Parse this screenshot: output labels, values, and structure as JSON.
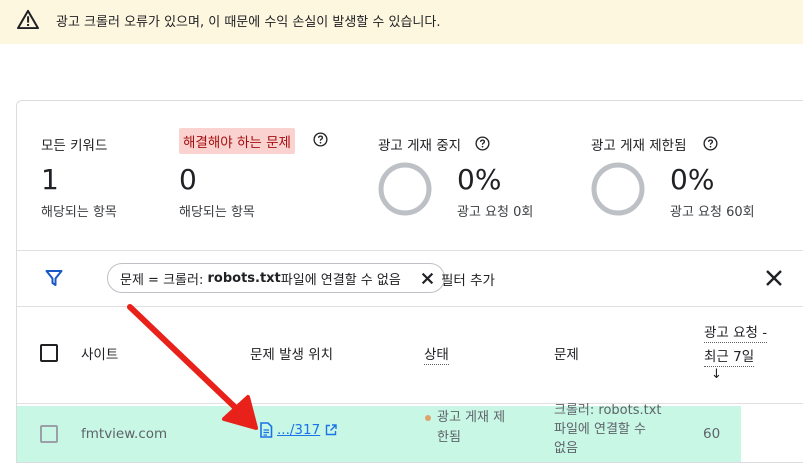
{
  "banner": {
    "message": "광고 크롤러 오류가 있으며, 이 때문에 수익 손실이 발생할 수 있습니다.",
    "icon": "warning-icon"
  },
  "stats": {
    "all_keywords": {
      "label": "모든 키워드",
      "value": "1",
      "sub": "해당되는 항목"
    },
    "to_resolve": {
      "label": "해결해야 하는 문제",
      "value": "0",
      "sub": "해당되는 항목"
    },
    "ad_stopped": {
      "label": "광고 게재 중지",
      "value": "0%",
      "sub": "광고 요청 0회"
    },
    "ad_limited": {
      "label": "광고 게재 제한됨",
      "value": "0%",
      "sub": "광고 요청 60회"
    }
  },
  "filter": {
    "chip_prefix": "문제 = 크롤러: ",
    "chip_bold": "robots.txt",
    "chip_suffix": " 파일에 연결할 수 없음",
    "add_label": "필터 추가"
  },
  "table": {
    "headers": {
      "site": "사이트",
      "location": "문제 발생 위치",
      "status": "상태",
      "issue": "문제",
      "requests_line1": "광고 요청 -",
      "requests_line2": "최근 7일",
      "sort_arrow": "↓"
    },
    "rows": [
      {
        "site": "fmtview.com",
        "location": ".../317",
        "status_line1": "광고 게재 제",
        "status_line2": "한됨",
        "issue_line1": "크롤러: robots.txt",
        "issue_line2": "파일에 연결할 수",
        "issue_line3": "없음",
        "requests": "60"
      }
    ]
  },
  "colors": {
    "banner_bg": "#fef7e0",
    "highlight_bg": "#fad2cf",
    "row_highlight": "#c8f7e6",
    "link": "#1a73e8",
    "filter_icon": "#1a57c7",
    "arrow": "#e8211b"
  }
}
